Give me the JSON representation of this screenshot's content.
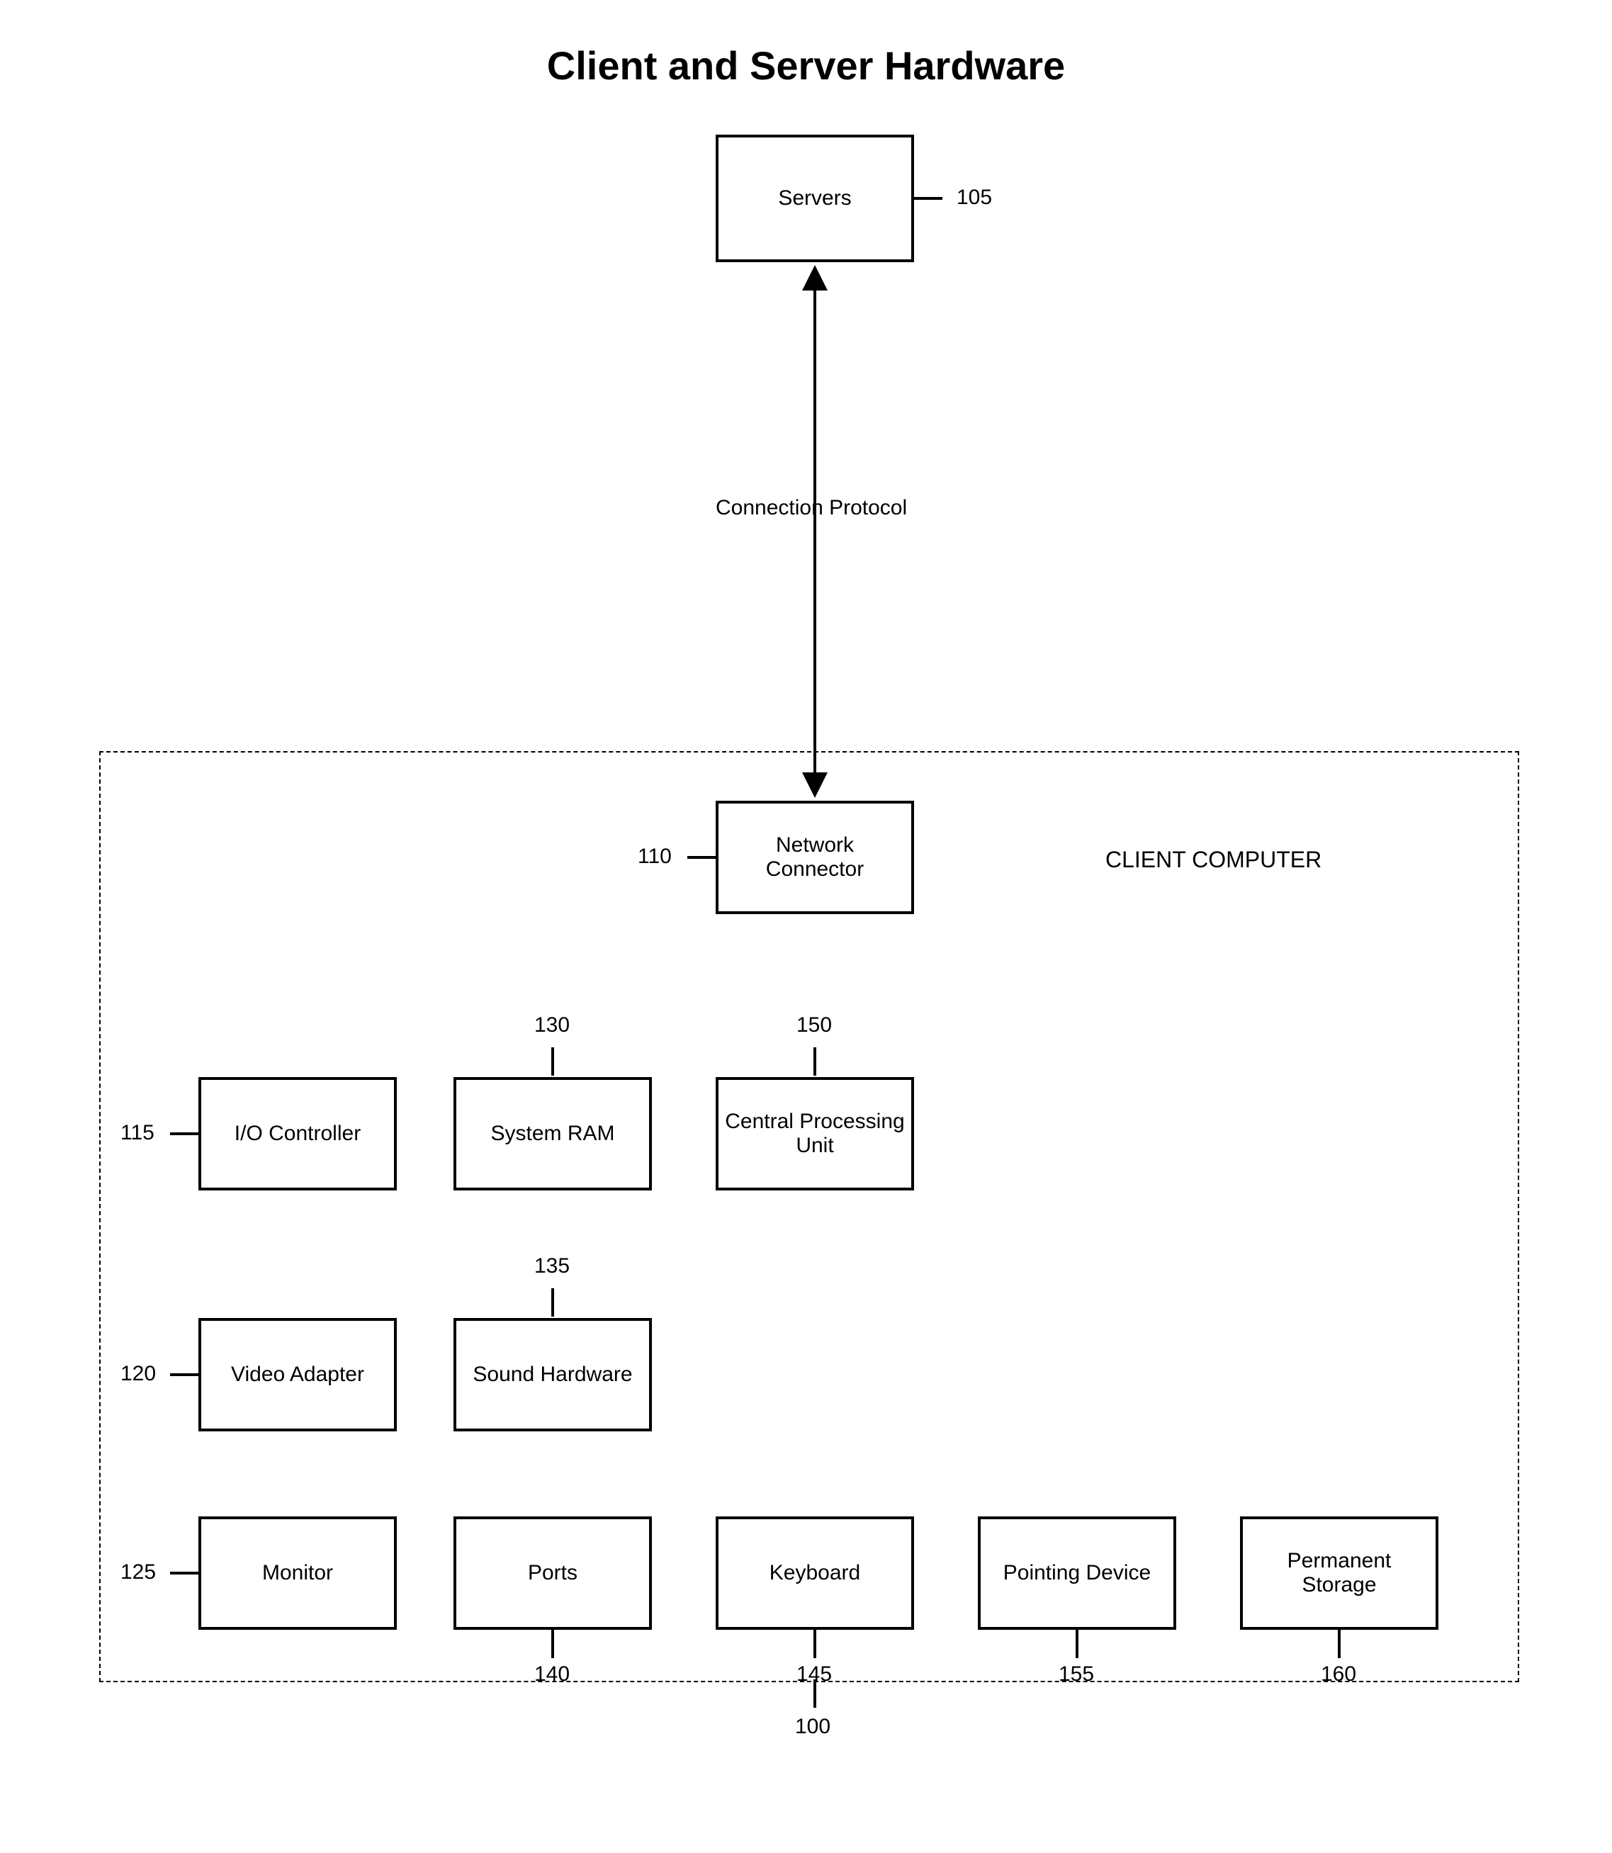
{
  "title": "Client and Server Hardware",
  "connection_label": "Connection Protocol",
  "client_label": "CLIENT COMPUTER",
  "refs": {
    "client": "100",
    "servers": "105",
    "network_connector": "110",
    "io_controller": "115",
    "video_adapter": "120",
    "monitor": "125",
    "system_ram": "130",
    "sound_hardware": "135",
    "ports": "140",
    "keyboard": "145",
    "cpu": "150",
    "pointing_device": "155",
    "storage": "160"
  },
  "boxes": {
    "servers": "Servers",
    "network_connector": "Network Connector",
    "io_controller": "I/O Controller",
    "system_ram": "System RAM",
    "cpu": "Central Processing Unit",
    "video_adapter": "Video Adapter",
    "sound_hardware": "Sound Hardware",
    "monitor": "Monitor",
    "ports": "Ports",
    "keyboard": "Keyboard",
    "pointing_device": "Pointing Device",
    "storage": "Permanent Storage"
  }
}
